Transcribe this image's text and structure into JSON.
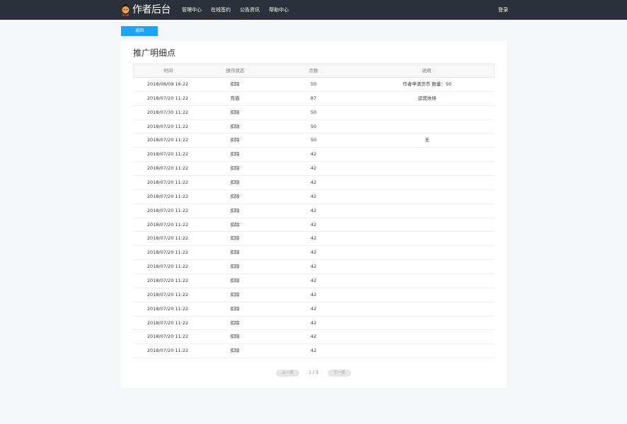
{
  "header": {
    "logo_text": "作者后台",
    "nav": [
      "管理中心",
      "在线签约",
      "公告资讯",
      "帮助中心"
    ],
    "login": "登录"
  },
  "back_label": "返回",
  "panel": {
    "title": "推广明细点"
  },
  "table": {
    "columns": [
      "时间",
      "操作状态",
      "点数",
      "说明"
    ],
    "rows": [
      [
        "2018/08/09 16:22",
        "扣除",
        "50",
        "作者申请货币 数量：50"
      ],
      [
        "2018/07/20 11:22",
        "充值",
        "87",
        "运营扶持"
      ],
      [
        "2018/07/30 11:22",
        "扣除",
        "50",
        ""
      ],
      [
        "2018/07/20 11:22",
        "扣除",
        "50",
        ""
      ],
      [
        "2018/07/20 11:22",
        "扣除",
        "50",
        "无"
      ],
      [
        "2018/07/20 11:22",
        "扣除",
        "42",
        ""
      ],
      [
        "2018/07/20 11:22",
        "扣除",
        "42",
        ""
      ],
      [
        "2018/07/20 11:22",
        "扣除",
        "42",
        ""
      ],
      [
        "2018/07/20 11:22",
        "扣除",
        "42",
        ""
      ],
      [
        "2018/07/20 11:22",
        "扣除",
        "42",
        ""
      ],
      [
        "2018/07/20 11:22",
        "扣除",
        "42",
        ""
      ],
      [
        "2018/07/20 11:22",
        "扣除",
        "42",
        ""
      ],
      [
        "2018/07/20 11:22",
        "扣除",
        "42",
        ""
      ],
      [
        "2018/07/20 11:22",
        "扣除",
        "42",
        ""
      ],
      [
        "2018/07/20 11:22",
        "扣除",
        "42",
        ""
      ],
      [
        "2018/07/20 11:22",
        "扣除",
        "42",
        ""
      ],
      [
        "2018/07/20 11:22",
        "扣除",
        "42",
        ""
      ],
      [
        "2018/07/20 11:22",
        "扣除",
        "42",
        ""
      ],
      [
        "2018/07/20 11:22",
        "扣除",
        "42",
        ""
      ],
      [
        "2018/07/20 11:22",
        "扣除",
        "42",
        ""
      ]
    ]
  },
  "pagination": {
    "prev": "上一页",
    "current": "1",
    "separator": " / ",
    "total": "3",
    "next": "下一页"
  },
  "colors": {
    "topbar": "#2c303b",
    "accent": "#1ea3f5",
    "background": "#f5f6f8"
  },
  "icons": {
    "logo": "author-mascot-icon"
  }
}
